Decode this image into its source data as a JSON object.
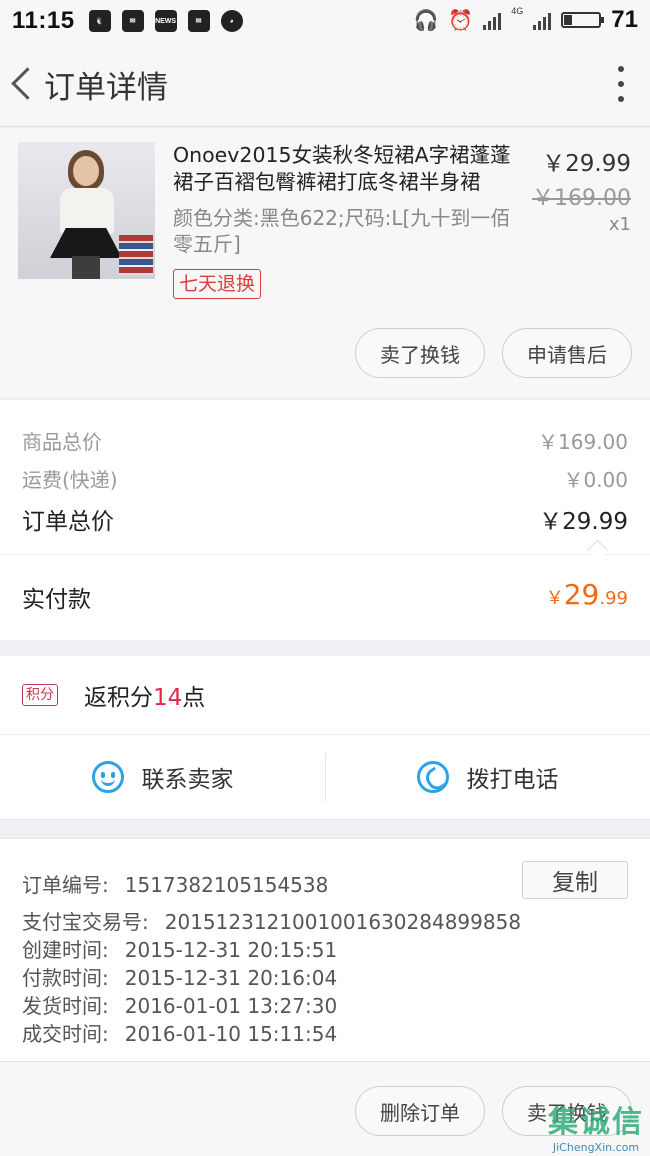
{
  "status_bar": {
    "time": "11:15",
    "icons": [
      "qq-icon",
      "message-icon",
      "news-icon",
      "mail-icon",
      "ball-icon"
    ],
    "news_label": "NEWS",
    "network": "4G",
    "battery": "71"
  },
  "nav": {
    "title": "订单详情"
  },
  "product": {
    "title": "Onoev2015女装秋冬短裙A字裙蓬蓬裙子百褶包臀裤裙打底冬裙半身裙",
    "spec": "颜色分类:黑色622;尺码:L[九十到一佰零五斤]",
    "tag": "七天退换",
    "price": "￥29.99",
    "original_price": "￥169.00",
    "quantity": "x1",
    "buttons": [
      "卖了换钱",
      "申请售后"
    ]
  },
  "prices": {
    "goods_label": "商品总价",
    "goods_value": "￥169.00",
    "shipping_label": "运费(快递)",
    "shipping_value": "￥0.00",
    "total_label": "订单总价",
    "total_value": "￥29.99",
    "paid_label": "实付款",
    "paid_currency": "￥",
    "paid_int": "29",
    "paid_dec": ".99"
  },
  "points": {
    "badge": "积分",
    "prefix": "返积分",
    "number": "14",
    "suffix": "点"
  },
  "contact": {
    "seller": "联系卖家",
    "phone": "拨打电话"
  },
  "info": {
    "order_no_label": "订单编号:",
    "order_no": "1517382105154538",
    "copy": "复制",
    "alipay_label": "支付宝交易号:",
    "alipay_no": "2015123121001001630284899858",
    "created_label": "创建时间:",
    "created": "2015-12-31 20:15:51",
    "paid_label": "付款时间:",
    "paid": "2015-12-31 20:16:04",
    "shipped_label": "发货时间:",
    "shipped": "2016-01-01 13:27:30",
    "done_label": "成交时间:",
    "done": "2016-01-10 15:11:54"
  },
  "bottom": {
    "delete": "删除订单",
    "sell": "卖了换钱"
  },
  "watermark": {
    "brand": "集诚信",
    "url": "JiChengXin.com"
  },
  "colors": {
    "accent_orange": "#f06b15",
    "tag_red": "#dd3e3e",
    "points_red": "#e0274a",
    "icon_blue": "#2ba3e6"
  }
}
